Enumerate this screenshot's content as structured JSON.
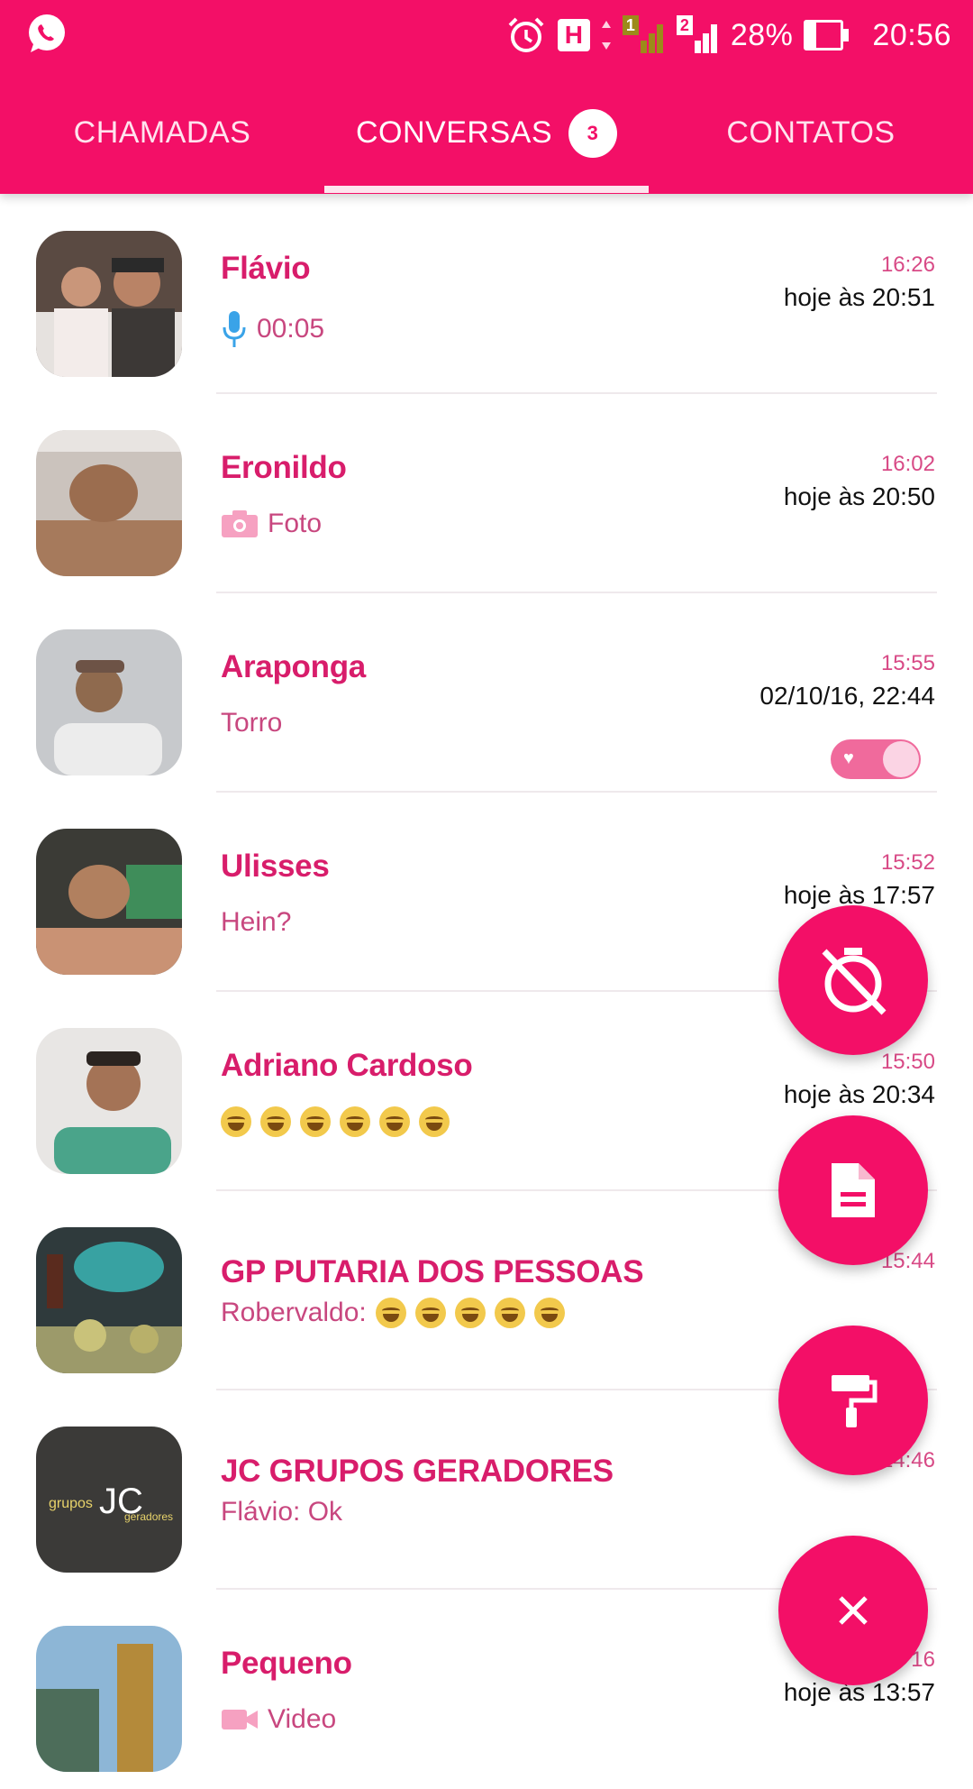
{
  "status_bar": {
    "battery_percent_label": "28%",
    "battery_level": 0.28,
    "clock": "20:56",
    "network_badge": "H",
    "sim1_label": "1",
    "sim2_label": "2",
    "icons": [
      "whatsapp-icon",
      "alarm-icon",
      "h-network-icon",
      "sim1-signal-icon",
      "sim2-signal-icon",
      "battery-icon"
    ]
  },
  "tabs": [
    {
      "label": "CHAMADAS",
      "active": false
    },
    {
      "label": "CONVERSAS",
      "active": true,
      "badge": "3"
    },
    {
      "label": "CONTATOS",
      "active": false
    }
  ],
  "chats": [
    {
      "name": "Flávio",
      "preview_icon": "mic-icon",
      "preview": "00:05",
      "time_top": "16:26",
      "time_main": "hoje às 20:51"
    },
    {
      "name": "Eronildo",
      "preview_icon": "camera-icon",
      "preview": "Foto",
      "time_top": "16:02",
      "time_main": "hoje às 20:50"
    },
    {
      "name": "Araponga",
      "preview": "Torro",
      "time_top": "15:55",
      "time_main": "02/10/16, 22:44",
      "toggle": true
    },
    {
      "name": "Ulisses",
      "preview": "Hein?",
      "time_top": "15:52",
      "time_main": "hoje às 17:57"
    },
    {
      "name": "Adriano Cardoso",
      "preview_emoji_count": 6,
      "time_top": "15:50",
      "time_main": "hoje às 20:34"
    },
    {
      "name": "GP PUTARIA DOS  PESSOAS",
      "preview_sender": "Robervaldo:",
      "preview_emoji_count": 5,
      "time_top": "15:44"
    },
    {
      "name": "JC GRUPOS GERADORES",
      "preview": "Flávio: Ok",
      "time_top": "14:46"
    },
    {
      "name": "Pequeno",
      "preview_icon": "video-icon",
      "preview": "Video",
      "time_top": "16",
      "time_main": "hoje às 13:57"
    }
  ],
  "fab_icons": [
    "timer-off-icon",
    "document-icon",
    "paint-roller-icon",
    "close-icon"
  ],
  "colors": {
    "accent": "#f30f67",
    "name": "#d81d6b",
    "preview": "#c8477f"
  }
}
